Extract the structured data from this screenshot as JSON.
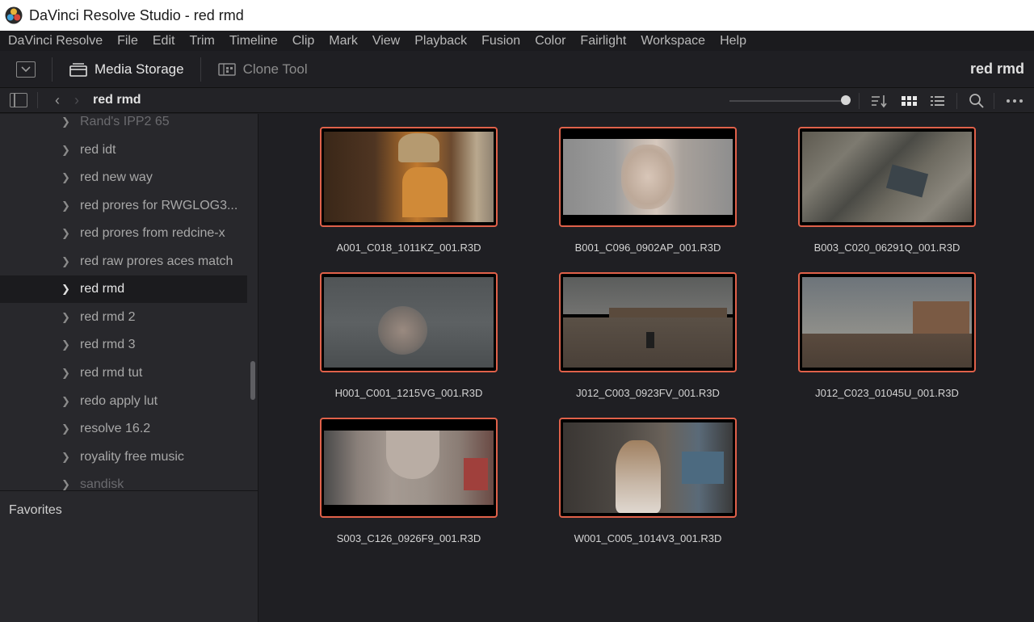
{
  "window": {
    "title": "DaVinci Resolve Studio - red rmd"
  },
  "menu": [
    "DaVinci Resolve",
    "File",
    "Edit",
    "Trim",
    "Timeline",
    "Clip",
    "Mark",
    "View",
    "Playback",
    "Fusion",
    "Color",
    "Fairlight",
    "Workspace",
    "Help"
  ],
  "toolbar": {
    "media_storage_label": "Media Storage",
    "clone_tool_label": "Clone Tool",
    "project_title": "red rmd"
  },
  "pathbar": {
    "current_path": "red rmd"
  },
  "sidebar": {
    "items": [
      "Rand's IPP2 65",
      "red idt",
      "red new way",
      "red prores for RWGLOG3...",
      "red prores from redcine-x",
      "red raw prores aces match",
      "red rmd",
      "red rmd 2",
      "red rmd 3",
      "red rmd tut",
      "redo apply lut",
      "resolve 16.2",
      "royality free music",
      "sandisk"
    ],
    "selected": "red rmd",
    "favorites_label": "Favorites"
  },
  "clips": [
    "A001_C018_1011KZ_001.R3D",
    "B001_C096_0902AP_001.R3D",
    "B003_C020_06291Q_001.R3D",
    "H001_C001_1215VG_001.R3D",
    "J012_C003_0923FV_001.R3D",
    "J012_C023_01045U_001.R3D",
    "S003_C126_0926F9_001.R3D",
    "W001_C005_1014V3_001.R3D"
  ],
  "colors": {
    "accent_border": "#e0614a",
    "background": "#1f1f23",
    "sidebar": "#28282c"
  }
}
